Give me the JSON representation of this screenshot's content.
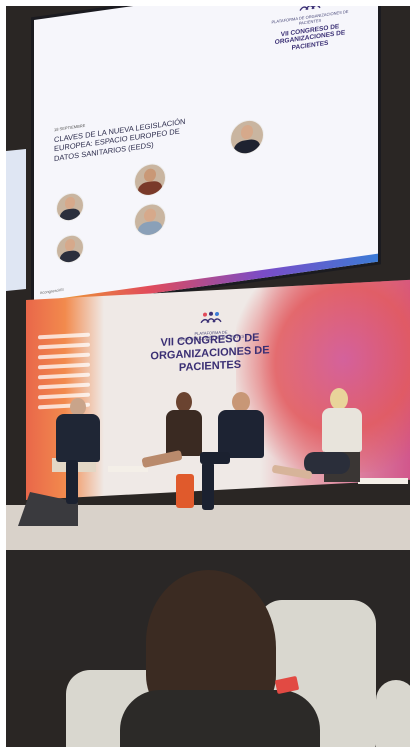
{
  "screen": {
    "org_name": "PLATAFORMA DE ORGANIZACIONES DE PACIENTES",
    "congress_title": "VII CONGRESO DE ORGANIZACIONES DE PACIENTES",
    "session_date": "18 SEPTIEMBRE",
    "session_title": "CLAVES DE LA NUEVA LEGISLACIÓN EUROPEA: ESPACIO EUROPEO DE DATOS SANITARIOS (EEDS)",
    "hashtag": "#congresoVII"
  },
  "backdrop": {
    "org_name": "PLATAFORMA DE ORGANIZACIONES DE PACIENTES",
    "congress_title": "VII CONGRESO DE ORGANIZACIONES DE PACIENTES"
  },
  "colors": {
    "brand": "#3a2f74",
    "accent_orange": "#f28a4d",
    "accent_pink": "#d0528a"
  }
}
